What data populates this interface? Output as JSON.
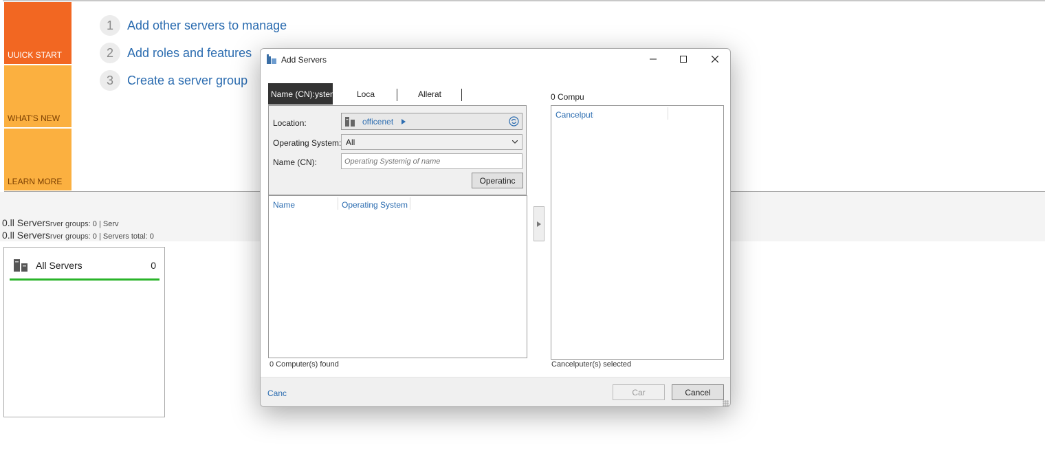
{
  "quick_tiles": {
    "quick_start": "UUICK START",
    "whats_new": "WHAT'S NEW",
    "learn_more": "LEARN MORE"
  },
  "steps": [
    {
      "num": "1",
      "label": "Add other servers to manage"
    },
    {
      "num": "2",
      "label": "Add roles and features"
    },
    {
      "num": "3",
      "label": "Create a server group"
    }
  ],
  "summary": {
    "line1_title": "0.ll Servers",
    "line1_rest": "rver groups: 0   |   Serv",
    "line2_title": "0.ll Servers",
    "line2_rest": "rver groups: 0   |   Servers total: 0"
  },
  "all_servers_card": {
    "title": "All Servers",
    "count": "0"
  },
  "dialog": {
    "title": "Add Servers",
    "tabs": [
      "Name (CN):ysten",
      "Loca",
      "Allerat"
    ],
    "location_label": "Location:",
    "location_value": "officenet",
    "os_label": "Operating System:",
    "os_value": "All",
    "name_label": "Name (CN):",
    "name_placeholder": "Operating Systemig of name",
    "find_button": "Operatinc",
    "list_columns": [
      "Name",
      "Operating System"
    ],
    "found_text": "0 Computer(s) found",
    "selected_label": "0 Compu",
    "selected_column": "Cancelputi",
    "selected_text": "Cancelputer(s) selected",
    "footer_link": "Canc",
    "ok_button": "Car",
    "cancel_button": "Cancel"
  }
}
